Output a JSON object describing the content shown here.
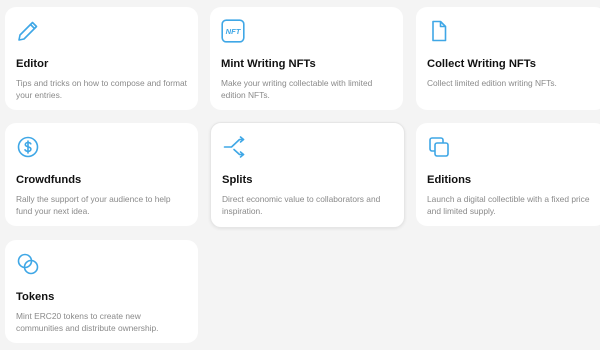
{
  "colors": {
    "background": "#f4f4f4",
    "card": "#ffffff",
    "accent": "#3fa7e6",
    "title": "#111111",
    "description": "#8a8a8a"
  },
  "cards": [
    {
      "title": "Editor",
      "description": "Tips and tricks on how to compose and format your entries.",
      "icon": "pencil-icon"
    },
    {
      "title": "Mint Writing NFTs",
      "description": "Make your writing collectable with limited edition NFTs.",
      "icon": "nft-badge-icon",
      "badge": "NFT"
    },
    {
      "title": "Collect Writing NFTs",
      "description": "Collect limited edition writing NFTs.",
      "icon": "document-icon"
    },
    {
      "title": "Crowdfunds",
      "description": "Rally the support of your audience to help fund your next idea.",
      "icon": "dollar-coin-icon"
    },
    {
      "title": "Splits",
      "description": "Direct economic value to collaborators and inspiration.",
      "icon": "split-arrows-icon"
    },
    {
      "title": "Editions",
      "description": "Launch a digital collectible with a fixed price and limited supply.",
      "icon": "copy-stack-icon"
    },
    {
      "title": "Tokens",
      "description": "Mint ERC20 tokens to create new communities and distribute ownership.",
      "icon": "coins-icon"
    }
  ]
}
